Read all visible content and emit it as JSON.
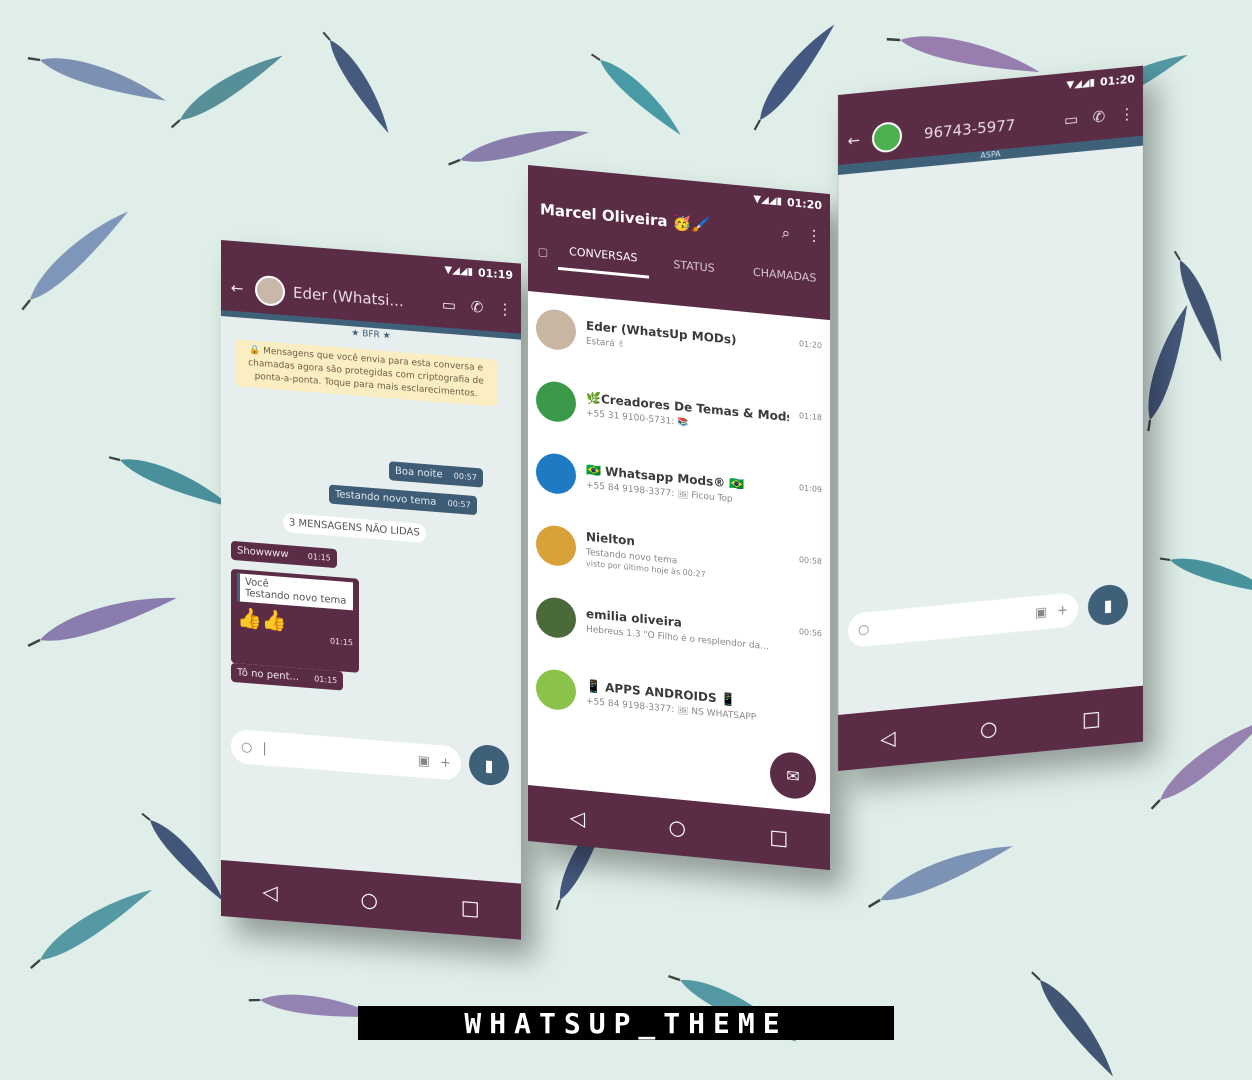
{
  "colors": {
    "accent": "#5b2c45",
    "secondary": "#3f6079",
    "chat_bg": "#e6efee"
  },
  "left_phone": {
    "time": "01:19",
    "contact_name": "Eder (Whatsi...",
    "banner_badge": "★ BFR ★",
    "encryption_notice": "🔒 Mensagens que você envia para esta conversa e chamadas agora são protegidas com criptografia de ponta-a-ponta. Toque para mais esclarecimentos.",
    "messages": [
      {
        "text": "Boa noite",
        "time": "00:57"
      },
      {
        "text": "Testando novo tema",
        "time": "00:57"
      }
    ],
    "unread_divider": "3 MENSAGENS NÃO LIDAS",
    "incoming": [
      {
        "text": "Showwww",
        "time": "01:15"
      }
    ],
    "quote": {
      "author": "Você",
      "text": "Testando novo tema"
    },
    "quote_emoji": "👍👍",
    "quote_time": "01:15",
    "last_msg": {
      "text": "Tô no pent...",
      "time": "01:15"
    }
  },
  "mid_phone": {
    "time": "01:20",
    "user_name": "Marcel Oliveira",
    "user_emoji": "🥳🖌️",
    "tabs": [
      "CONVERSAS",
      "STATUS",
      "CHAMADAS"
    ],
    "chats": [
      {
        "name": "Eder (WhatsUp MODs)",
        "msg": "Estará ✌",
        "time": "01:20"
      },
      {
        "name": "🌿Creadores De Temas & Mods...",
        "msg": "+55 31 9100-5731: 📚",
        "time": "01:18"
      },
      {
        "name": "🇧🇷 Whatsapp Mods® 🇧🇷",
        "msg": "+55 84 9198-3377: 🖼 Ficou Top",
        "time": "01:09"
      },
      {
        "name": "Nielton",
        "msg": "Testando novo tema",
        "time": "00:58"
      },
      {
        "name": "emilia oliveira",
        "msg": "Hebreus 1.3 \"O Filho é o resplendor da...",
        "time": "00:56"
      },
      {
        "name": "📱 APPS ANDROIDS 📱",
        "msg": "+55 84 9198-3377: 🖼 NS WHATSAPP",
        "time": ""
      }
    ],
    "last_seen": "visto por último hoje às 00:27"
  },
  "right_phone": {
    "time": "01:20",
    "contact_name": "96743-5977",
    "banner": "ASPA"
  },
  "watermark": "WHATSUP_THEME"
}
